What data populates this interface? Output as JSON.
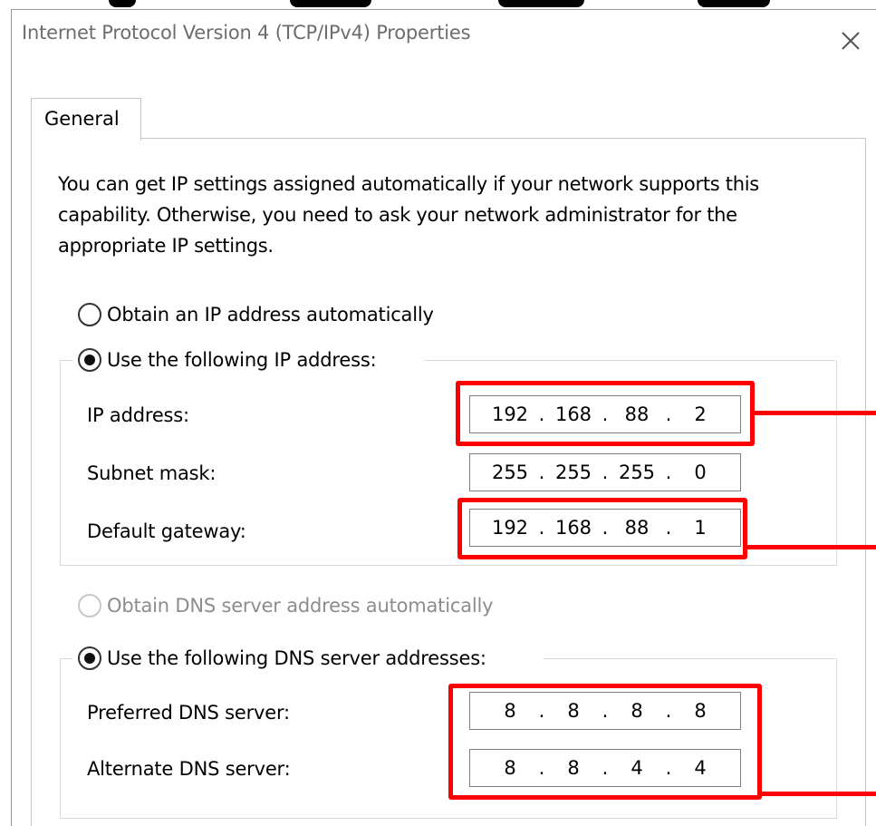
{
  "window": {
    "title": "Internet Protocol Version 4 (TCP/IPv4) Properties",
    "tab_general": "General"
  },
  "intro_text": "You can get IP settings assigned automatically if your network supports this capability. Otherwise, you need to ask your network administrator for the appropriate IP settings.",
  "ip_mode": {
    "auto_label": "Obtain an IP address automatically",
    "manual_label": "Use the following IP address:",
    "selected": "manual"
  },
  "ip_fields": {
    "ip_address": {
      "label": "IP address:",
      "octets": [
        "192",
        "168",
        "88",
        "2"
      ]
    },
    "subnet_mask": {
      "label": "Subnet mask:",
      "octets": [
        "255",
        "255",
        "255",
        "0"
      ]
    },
    "default_gateway": {
      "label": "Default gateway:",
      "octets": [
        "192",
        "168",
        "88",
        "1"
      ]
    }
  },
  "dns_mode": {
    "auto_label": "Obtain DNS server address automatically",
    "manual_label": "Use the following DNS server addresses:",
    "selected": "manual"
  },
  "dns_fields": {
    "preferred": {
      "label": "Preferred DNS server:",
      "octets": [
        "8",
        "8",
        "8",
        "8"
      ]
    },
    "alternate": {
      "label": "Alternate DNS server:",
      "octets": [
        "8",
        "8",
        "4",
        "4"
      ]
    }
  },
  "colors": {
    "highlight": "#ff0000",
    "disabled_text": "#8d8d8d"
  }
}
